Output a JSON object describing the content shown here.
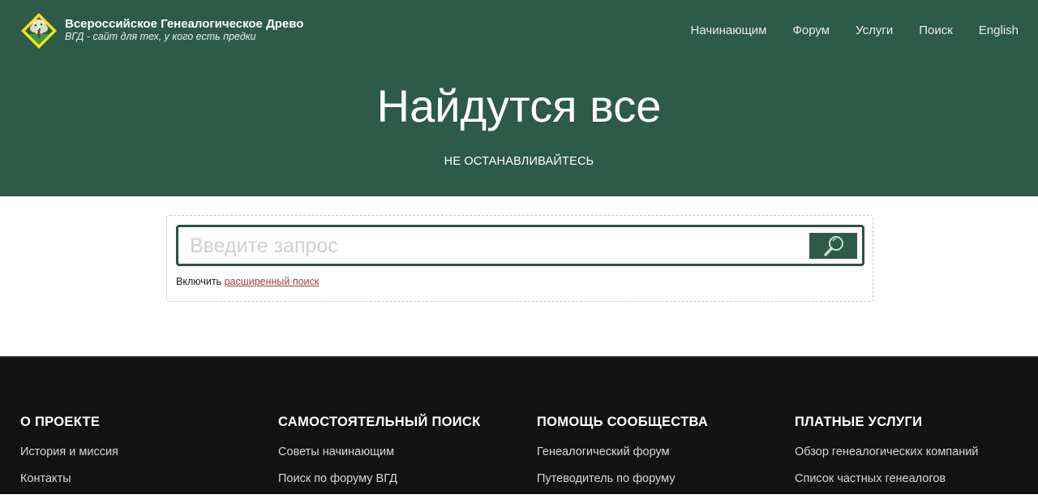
{
  "header": {
    "logo_icon": "tree-diamond-logo",
    "title": "Всероссийское Генеалогическое Древо",
    "subtitle": "ВГД - сайт для тех, у кого есть предки",
    "nav": [
      {
        "label": "Начинающим"
      },
      {
        "label": "Форум"
      },
      {
        "label": "Услуги"
      },
      {
        "label": "Поиск"
      },
      {
        "label": "English"
      }
    ]
  },
  "hero": {
    "title": "Найдутся все",
    "subtitle": "НЕ ОСТАНАВЛИВАЙТЕСЬ"
  },
  "search": {
    "placeholder": "Введите запрос",
    "value": "",
    "button_icon": "search-icon",
    "advanced_prefix": "Включить",
    "advanced_link": "расширенный поиск"
  },
  "footer": {
    "columns": [
      {
        "title": "О ПРОЕКТЕ",
        "links": [
          "История и миссия",
          "Контакты"
        ]
      },
      {
        "title": "САМОСТОЯТЕЛЬНЫЙ ПОИСК",
        "links": [
          "Советы начинающим",
          "Поиск по форуму ВГД"
        ]
      },
      {
        "title": "ПОМОЩЬ СООБЩЕСТВА",
        "links": [
          "Генеалогический форум",
          "Путеводитель по форуму"
        ]
      },
      {
        "title": "ПЛАТНЫЕ УСЛУГИ",
        "links": [
          "Обзор генеалогических компаний",
          "Список частных генеалогов"
        ]
      }
    ]
  },
  "colors": {
    "header_bg": "#2e5a4a",
    "footer_bg": "#121212",
    "link_accent": "#a0403e",
    "logo_yellow": "#f2e21a"
  }
}
